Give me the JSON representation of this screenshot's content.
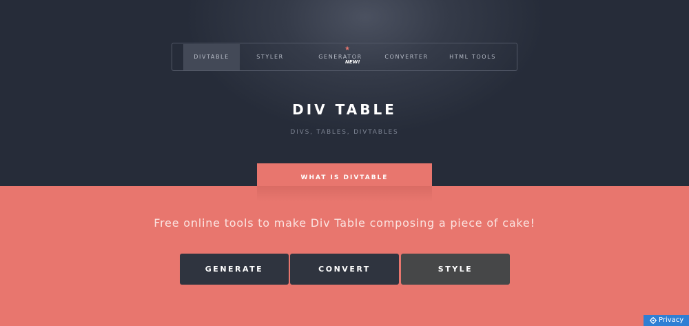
{
  "nav": {
    "items": [
      {
        "label": "DIVTABLE",
        "active": true
      },
      {
        "label": "STYLER",
        "active": false
      },
      {
        "label": "GENERATOR",
        "active": false
      },
      {
        "label": "CONVERTER",
        "active": false
      },
      {
        "label": "HTML TOOLS",
        "active": false
      }
    ],
    "new_badge": "NEW!"
  },
  "hero": {
    "title": "DIV TABLE",
    "subtitle": "DIVS, TABLES, DIVTABLES"
  },
  "tab": {
    "label": "WHAT IS DIVTABLE"
  },
  "main": {
    "tagline": "Free online tools to make Div Table composing a piece of cake!",
    "buttons": [
      {
        "label": "GENERATE"
      },
      {
        "label": "CONVERT"
      },
      {
        "label": "STYLE"
      }
    ]
  },
  "privacy": {
    "label": "Privacy",
    "icon": "gear-icon"
  },
  "colors": {
    "hero_dark": "#262c39",
    "accent": "#e8766e",
    "button_dark": "#2f343f",
    "button_grey": "#464748",
    "privacy_blue": "#2f7fd4"
  }
}
